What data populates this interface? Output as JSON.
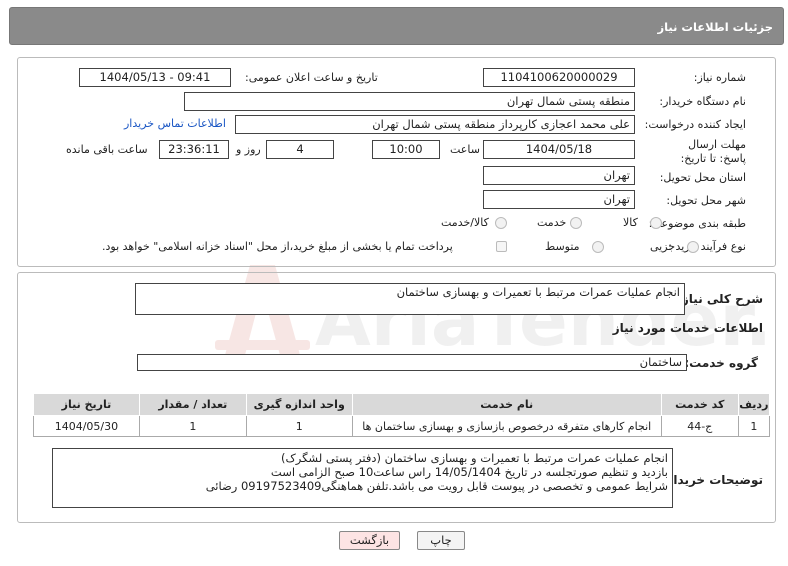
{
  "header": {
    "title": "جزئیات اطلاعات نیاز"
  },
  "fields": {
    "need_number_label": "شماره نیاز:",
    "need_number": "1104100620000029",
    "announce_label": "تاریخ و ساعت اعلان عمومی:",
    "announce_value": "1404/05/13 - 09:41",
    "buyer_label": "نام دستگاه خریدار:",
    "buyer_value": "منطقه پستی شمال تهران",
    "creator_label": "ایجاد کننده درخواست:",
    "creator_value": "علی محمد اعجازی کارپرداز منطقه پستی شمال تهران",
    "contact_link": "اطلاعات تماس خریدار",
    "deadline_label": "مهلت ارسال پاسخ: تا تاریخ:",
    "deadline_date": "1404/05/18",
    "time_label": "ساعت",
    "deadline_time": "10:00",
    "days_value": "4",
    "days_label": "روز و",
    "remaining_time": "23:36:11",
    "remaining_label": "ساعت باقی مانده",
    "province_label": "استان محل تحویل:",
    "province_value": "تهران",
    "city_label": "شهر محل تحویل:",
    "city_value": "تهران",
    "category_label": "طبقه بندی موضوعی:",
    "category_options": [
      "کالا",
      "خدمت",
      "کالا/خدمت"
    ],
    "process_label": "نوع فرآیند خرید :",
    "process_options": [
      "جزیی",
      "متوسط"
    ],
    "payment_note": "پرداخت تمام یا بخشی از مبلغ خرید،از محل \"اسناد خزانه اسلامی\" خواهد بود."
  },
  "summary": {
    "label": "شرح کلی نیاز:",
    "value": "انجام عملیات عمرات مرتبط با تعمیرات و بهسازی ساختمان"
  },
  "services": {
    "section_title": "اطلاعات خدمات مورد نیاز",
    "group_label": "گروه خدمت:",
    "group_value": "ساختمان",
    "table": {
      "headers": [
        "ردیف",
        "کد خدمت",
        "نام خدمت",
        "واحد اندازه گیری",
        "تعداد / مقدار",
        "تاریخ نیاز"
      ],
      "rows": [
        [
          "1",
          "ج-44",
          "انجام کارهای متفرقه درخصوص بازسازی و بهسازی ساختمان ها",
          "1",
          "1",
          "1404/05/30"
        ]
      ]
    }
  },
  "buyer_notes": {
    "label": "توضیحات خریدار:",
    "lines": [
      "انجام عملیات عمرات مرتبط با تعمیرات و بهسازی ساختمان (دفتر پستی لشگرک)",
      "بازدید و تنظیم صورتجلسه در تاریخ 14/05/1404 راس ساعت10 صبح الزامی است",
      "شرایط عمومی و تخصصی در پیوست قابل رویت می باشد.تلفن هماهنگی09197523409 رضائی"
    ]
  },
  "buttons": {
    "print": "چاپ",
    "back": "بازگشت"
  },
  "watermark": {
    "text": "AriaTender.net"
  },
  "colors": {
    "header": "#8a8a8a",
    "link": "#1a56c4",
    "back_button": "#fde4e4",
    "watermark": "#c0392b"
  }
}
